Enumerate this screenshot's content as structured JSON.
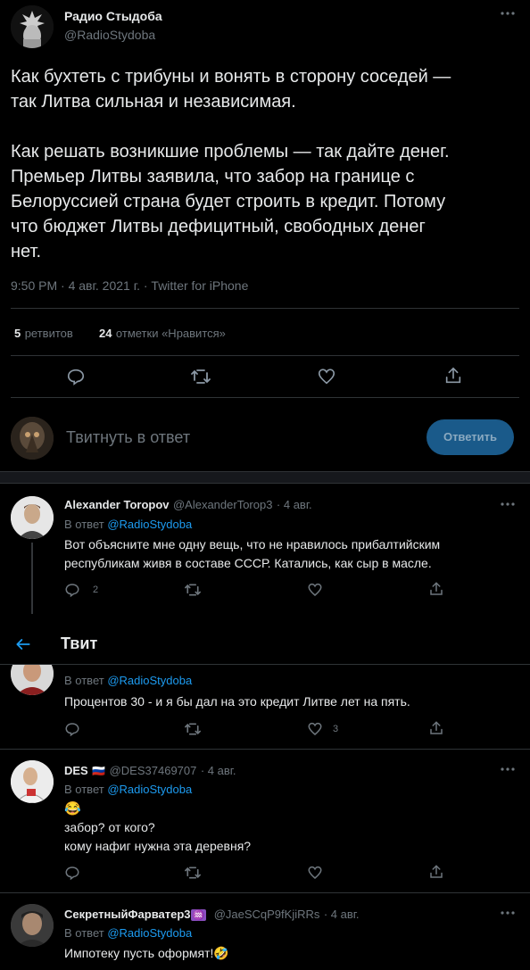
{
  "main_tweet": {
    "author_name": "Радио Стыдоба",
    "author_handle": "@RadioStydoba",
    "text": "Как бухтеть с трибуны и вонять в сторону соседей —\nтак Литва сильная и независимая.\n\nКак решать возникшие проблемы — так дайте денег.\nПремьер Литвы заявила, что забор на границе с\nБелоруссией страна будет строить в кредит. Потому\nчто бюджет Литвы дефицитный, свободных денег\nнет.",
    "timestamp": "9:50 PM · 4 авг. 2021 г. · Twitter for iPhone",
    "retweets_count": "5",
    "retweets_label": "ретвитов",
    "likes_count": "24",
    "likes_label": "отметки «Нравится»"
  },
  "compose": {
    "placeholder": "Твитнуть в ответ",
    "button_label": "Ответить"
  },
  "topbar": {
    "title": "Твит"
  },
  "replies": [
    {
      "name": "Alexander Toropov",
      "handle": "@AlexanderTorop3",
      "date": "· 4 авг.",
      "reply_to_prefix": "В ответ",
      "reply_to": "@RadioStydoba",
      "text": "Вот объясните мне одну вещь, что не нравилось прибалтийским\nреспубликам живя в составе СССР. Катались, как сыр в масле.",
      "reply_count": "2"
    },
    {
      "reply_to_prefix": "В ответ",
      "reply_to": "@RadioStydoba",
      "text": "Процентов 30 - и я бы дал на это кредит Литве лет на пять.",
      "like_count": "3"
    },
    {
      "name": "DES",
      "flag": "🇷🇺",
      "handle": "@DES37469707",
      "date": "· 4 авг.",
      "reply_to_prefix": "В ответ",
      "reply_to": "@RadioStydoba",
      "emoji": "😂",
      "text": "забор? от кого?\nкому нафиг нужна эта деревня?"
    },
    {
      "name": "СекретныйФарватер3",
      "name_emoji": "♒",
      "handle": "@JaeSCqP9fKjiRRs",
      "date": "· 4 авг.",
      "reply_to_prefix": "В ответ",
      "reply_to": "@RadioStydoba",
      "text": "Импотеку пусть оформят!🤣"
    }
  ],
  "colors": {
    "background": "#000000",
    "accent": "#1d9bf0",
    "muted": "#6e767d",
    "divider": "#2f3336",
    "reply_button": "#1a5a8a"
  },
  "icons": [
    "reply-icon",
    "retweet-icon",
    "like-icon",
    "share-icon",
    "more-icon",
    "back-arrow-icon"
  ]
}
